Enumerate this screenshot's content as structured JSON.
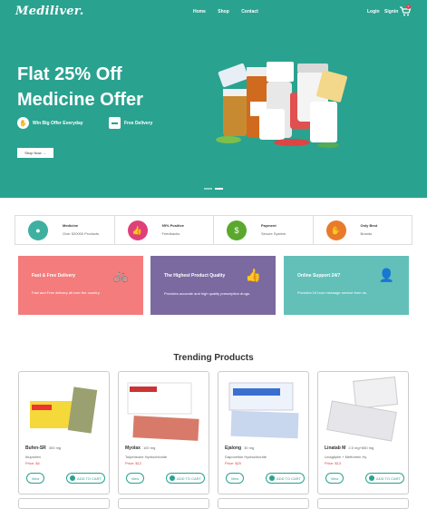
{
  "nav": {
    "logo": "Mediliver.",
    "links": [
      "Home",
      "Shop",
      "Contact"
    ],
    "login": "Login",
    "signup": "Signin",
    "cart_count": "0"
  },
  "hero": {
    "title_line1": "Flat 25% Off",
    "title_line2": "Medicine Offer",
    "feature1": "Win Big Offer Everyday",
    "feature2": "Free Delivery",
    "shop_button": "Shop Now  →",
    "accent": "#2aa290"
  },
  "info": [
    {
      "title": "Medicine",
      "sub": "Over 520000 Products",
      "color": "#3fb0a0"
    },
    {
      "title": "95% Positive",
      "sub": "Feedbacks",
      "color": "#e0407a"
    },
    {
      "title": "Payment",
      "sub": "Secure System",
      "color": "#5aa82e"
    },
    {
      "title": "Only Best",
      "sub": "Brands",
      "color": "#e87a2a"
    }
  ],
  "cards": [
    {
      "title": "Fast & Free Delivery",
      "desc": "Fast and Free delivery all over the country.",
      "color": "#f47c7c"
    },
    {
      "title": "The Highest Product Quality",
      "desc": "Provides accurate and high quality prescription drugs.",
      "color": "#7b6aa0"
    },
    {
      "title": "Online Support 24/7",
      "desc": "Provides 24 hour message service from us.",
      "color": "#62c0b9"
    }
  ],
  "section_title": "Trending Products",
  "products": [
    {
      "name": "Bufen-SR",
      "strength": "300 mg",
      "generic": "Ibuprofen",
      "price": "Price: $4",
      "view": "View",
      "cart": "ADD TO CART"
    },
    {
      "name": "Myolax",
      "strength": "100 mg",
      "generic": "Tolperisone Hydrochloride",
      "price": "Price: $12",
      "view": "View",
      "cart": "ADD TO CART"
    },
    {
      "name": "Ejalong",
      "strength": "30 mg",
      "generic": "Dapoxetine Hydrochloride",
      "price": "Price: $20",
      "view": "View",
      "cart": "ADD TO CART"
    },
    {
      "name": "Linatab M",
      "strength": "2.5 mg+850 mg",
      "generic": "Linagliptin + Metformin Hy",
      "price": "Price: $13",
      "view": "View",
      "cart": "ADD TO CART"
    }
  ]
}
